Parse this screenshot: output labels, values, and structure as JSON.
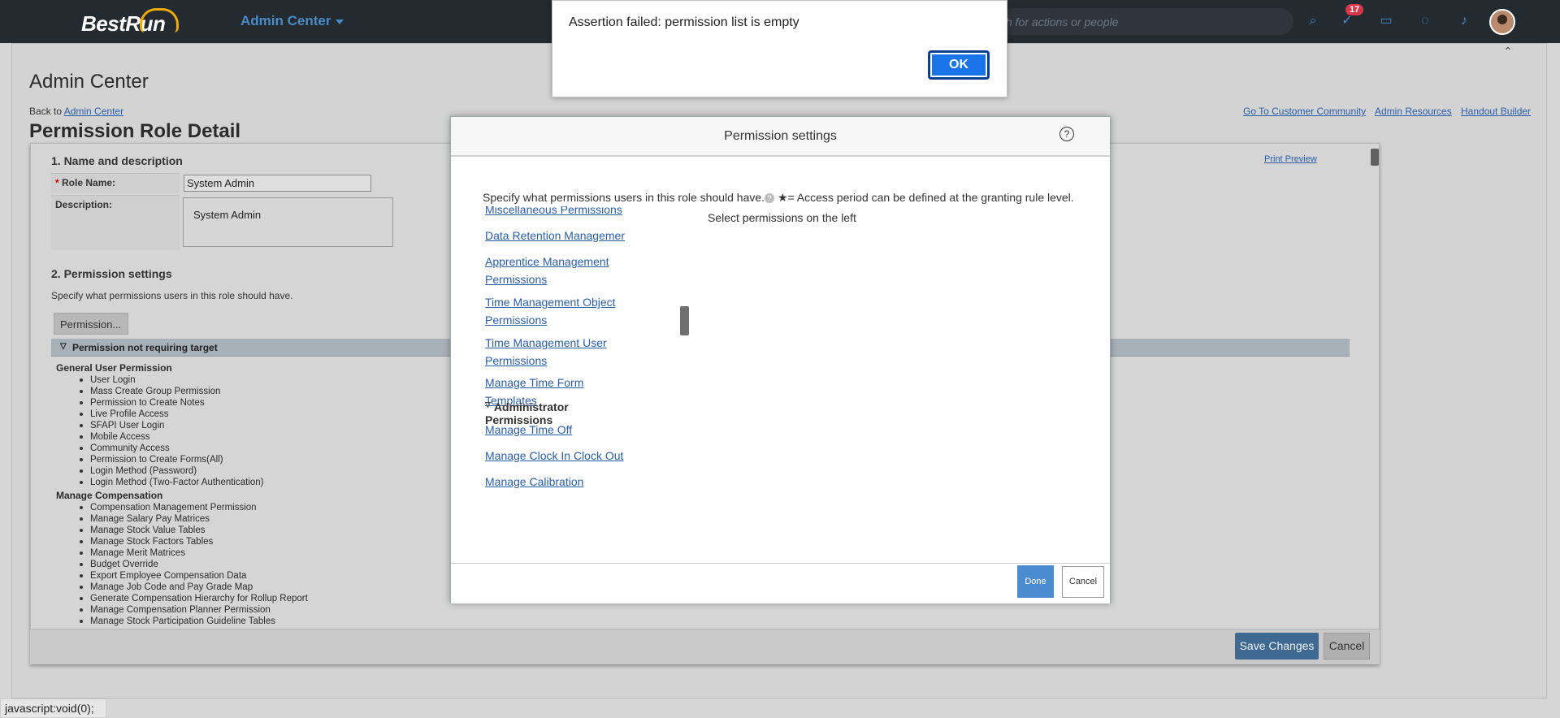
{
  "shell": {
    "logo": "BestRun",
    "module_menu": "Admin Center",
    "search_placeholder": "h for actions or people",
    "notification_count": "17"
  },
  "page": {
    "title": "Admin Center",
    "back_prefix": "Back to ",
    "back_link": "Admin Center",
    "role_title": "Permission Role Detail",
    "top_links": [
      "Go To Customer Community",
      "Admin Resources",
      "Handout Builder"
    ],
    "section1_title": "1. Name and description",
    "print_preview": "Print Preview",
    "role_name_label": "Role Name:",
    "role_name_required": "*",
    "role_name_value": "System Admin",
    "description_label": "Description:",
    "description_value": "System Admin",
    "section2_title": "2. Permission settings",
    "section2_sub": "Specify what permissions users in this role should have.",
    "permission_button": "Permission...",
    "group_bar": "Permission not requiring target",
    "categories": [
      {
        "name": "General User Permission",
        "items": [
          "User Login",
          "Mass Create Group Permission",
          "Permission to Create Notes",
          "Live Profile Access",
          "SFAPI User Login",
          "Mobile Access",
          "Community Access",
          "Permission to Create Forms(All)",
          "Login Method (Password)",
          "Login Method (Two-Factor Authentication)"
        ]
      },
      {
        "name": "Manage Compensation",
        "items": [
          "Compensation Management Permission",
          "Manage Salary Pay Matrices",
          "Manage Stock Value Tables",
          "Manage Stock Factors Tables",
          "Manage Merit Matrices",
          "Budget Override",
          "Export Employee Compensation Data",
          "Manage Job Code and Pay Grade Map",
          "Generate Compensation Hierarchy for Rollup Report",
          "Manage Compensation Planner Permission",
          "Manage Stock Participation Guideline Tables"
        ]
      }
    ],
    "save_changes": "Save Changes",
    "cancel": "Cancel"
  },
  "modal": {
    "title": "Permission settings",
    "intro": "Specify what permissions users in this role should have.",
    "intro_suffix": " ★= Access period can be defined at the granting rule level.",
    "select_hint": "Select permissions on the left",
    "links_top": [
      "Miscellaneous Permissions",
      "Data Retention Management",
      "Apprentice Management Permissions",
      "Time Management Object Permissions",
      "Time Management User Permissions",
      "Manage Time Form Templates"
    ],
    "admin_header": "Administrator Permissions",
    "links_admin": [
      "Manage Time Off",
      "Manage Clock In Clock Out",
      "Manage Calibration"
    ],
    "done": "Done",
    "cancel": "Cancel"
  },
  "alert": {
    "message": "Assertion failed: permission list is empty",
    "ok": "OK"
  },
  "status_bar": "javascript:void(0);"
}
